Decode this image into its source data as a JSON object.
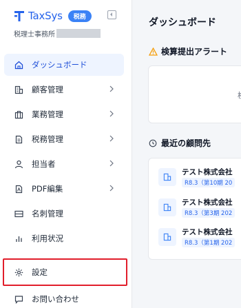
{
  "brand": {
    "name": "TaxSys",
    "badge": "税務"
  },
  "office": {
    "label": "税理士事務所"
  },
  "nav": {
    "items": [
      {
        "label": "ダッシュボード",
        "icon": "home-icon",
        "active": true
      },
      {
        "label": "顧客管理",
        "icon": "building-icon",
        "chevron": true
      },
      {
        "label": "業務管理",
        "icon": "briefcase-icon",
        "chevron": true
      },
      {
        "label": "税務管理",
        "icon": "document-icon",
        "chevron": true
      },
      {
        "label": "担当者",
        "icon": "user-icon",
        "chevron": true
      },
      {
        "label": "PDF編集",
        "icon": "pdf-icon",
        "chevron": true
      },
      {
        "label": "名刺管理",
        "icon": "card-icon"
      },
      {
        "label": "利用状況",
        "icon": "bar-chart-icon"
      },
      {
        "label": "設定",
        "icon": "gear-icon",
        "highlighted": true
      },
      {
        "label": "お問い合わせ",
        "icon": "chat-icon"
      }
    ]
  },
  "main": {
    "title": "ダッシュボード",
    "alert_section": {
      "title": "検算提出アラート",
      "card_text": "検"
    },
    "recent_section": {
      "title": "最近の顧問先"
    },
    "clients": [
      {
        "name": "テスト株式会社",
        "period": "R8.3（第10期 20"
      },
      {
        "name": "テスト株式会社",
        "period": "R8.3（第3期 202"
      },
      {
        "name": "テスト株式会社",
        "period": "R8.3（第1期 202"
      }
    ]
  },
  "colors": {
    "accent": "#2563eb",
    "active_bg": "#eef4ff",
    "highlight_border": "#e11d2a",
    "alert": "#f59e0b"
  }
}
